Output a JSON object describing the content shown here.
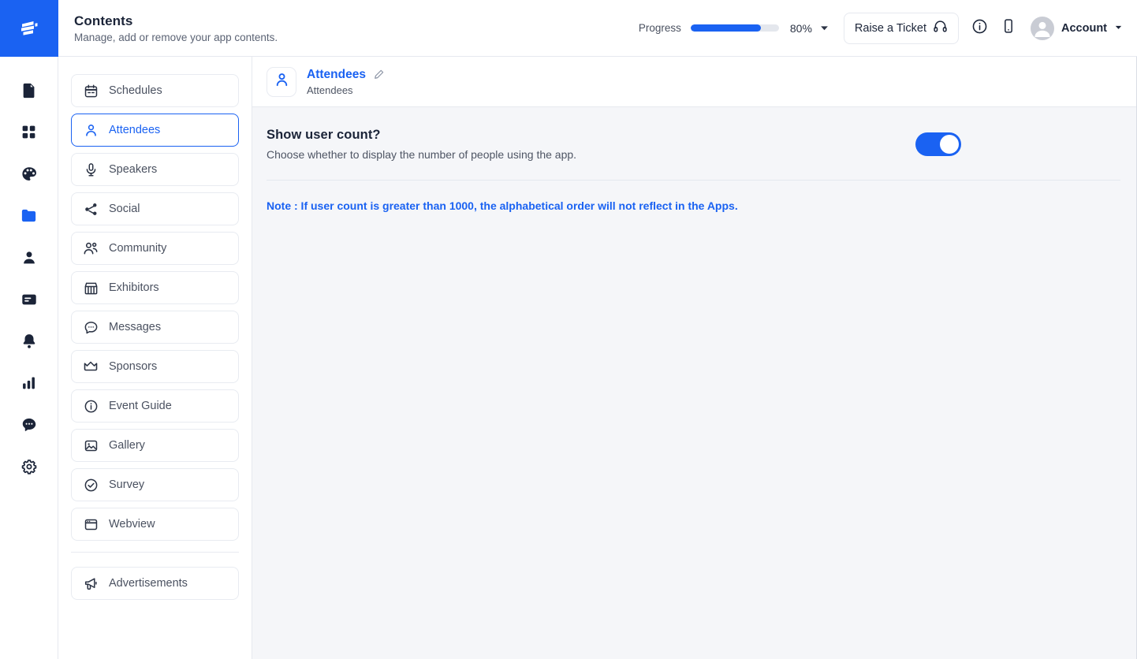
{
  "brand": {
    "logo_icon": "stacked-bars-logo",
    "accent": "#1a62f2"
  },
  "header": {
    "title": "Contents",
    "subtitle": "Manage, add or remove your app contents.",
    "progress_label": "Progress",
    "progress_value": 80,
    "progress_percent": "80%",
    "caret_icon": "chevron-down-icon",
    "ticket_label": "Raise a Ticket",
    "ticket_icon": "headset-icon",
    "info_icon": "info-circle-icon",
    "mobile_icon": "mobile-phone-icon",
    "avatar_icon": "user-avatar-icon",
    "account_label": "Account",
    "account_caret_icon": "caret-down-icon"
  },
  "rail": {
    "items": [
      {
        "icon": "document-icon",
        "active": false
      },
      {
        "icon": "grid-apps-icon",
        "active": false
      },
      {
        "icon": "palette-icon",
        "active": false
      },
      {
        "icon": "folder-icon",
        "active": true
      },
      {
        "icon": "person-icon",
        "active": false
      },
      {
        "icon": "card-list-icon",
        "active": false
      },
      {
        "icon": "bell-icon",
        "active": false
      },
      {
        "icon": "bar-chart-icon",
        "active": false
      },
      {
        "icon": "chat-bubble-icon",
        "active": false
      },
      {
        "icon": "gear-icon",
        "active": false
      }
    ]
  },
  "menu": {
    "items": [
      {
        "label": "Schedules",
        "icon": "calendar-icon",
        "active": false
      },
      {
        "label": "Attendees",
        "icon": "person-icon",
        "active": true
      },
      {
        "label": "Speakers",
        "icon": "microphone-icon",
        "active": false
      },
      {
        "label": "Social",
        "icon": "share-icon",
        "active": false
      },
      {
        "label": "Community",
        "icon": "people-icon",
        "active": false
      },
      {
        "label": "Exhibitors",
        "icon": "store-icon",
        "active": false
      },
      {
        "label": "Messages",
        "icon": "chat-bubble-icon",
        "active": false
      },
      {
        "label": "Sponsors",
        "icon": "crown-icon",
        "active": false
      },
      {
        "label": "Event Guide",
        "icon": "info-circle-icon",
        "active": false
      },
      {
        "label": "Gallery",
        "icon": "image-icon",
        "active": false
      },
      {
        "label": "Survey",
        "icon": "check-circle-icon",
        "active": false
      },
      {
        "label": "Webview",
        "icon": "browser-window-icon",
        "active": false
      }
    ],
    "footer": [
      {
        "label": "Advertisements",
        "icon": "megaphone-icon",
        "active": false
      }
    ]
  },
  "content": {
    "icon": "person-icon",
    "title": "Attendees",
    "edit_icon": "pencil-edit-icon",
    "subtitle": "Attendees",
    "setting": {
      "title": "Show user count?",
      "description": "Choose whether to display the number of people using the app.",
      "toggle_on": true
    },
    "note": "Note : If user count is greater than 1000, the alphabetical order will not reflect in the Apps."
  }
}
